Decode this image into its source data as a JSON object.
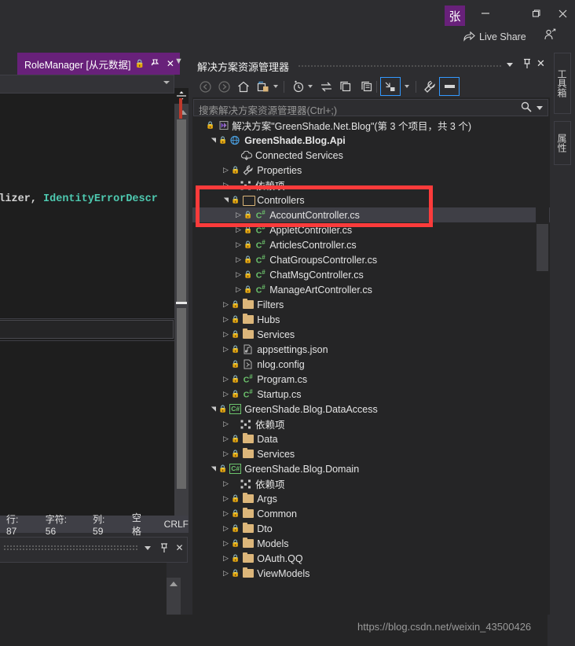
{
  "titlebar": {
    "avatar_initial": "张",
    "minimize_label": "minimize",
    "maximize_label": "maximize",
    "close_label": "close",
    "live_share_label": "Live Share",
    "accent_purple": "#68217a"
  },
  "editor": {
    "tab_label": "RoleManager [从元数据]",
    "tab_lock_icon": "lock-icon",
    "tab_pin_icon": "pin-icon",
    "tab_close_icon": "close-icon",
    "code_fragment_plain": "rmalizer, ",
    "code_fragment_type": "IdentityErrorDescr",
    "code_color_type": "#4ec9b0",
    "code_color_plain": "#d4d4d4"
  },
  "statusbar": {
    "line_label": "行: 87",
    "char_label": "字符: 56",
    "col_label": "列: 59",
    "whitespace_label": "空格",
    "eol_label": "CRLF"
  },
  "bottom_window": {
    "caret_icon": "chevron-down-icon",
    "pin_icon": "pin-icon",
    "close_icon": "close-icon"
  },
  "solution_explorer": {
    "title": "解决方案资源管理器",
    "caret_icon": "chevron-down-icon",
    "pin_icon": "pin-icon",
    "close_icon": "close-icon",
    "search_placeholder": "搜索解决方案资源管理器(Ctrl+;)",
    "search_icon": "magnifier-icon",
    "toolbar": [
      {
        "name": "back-button",
        "icon": "arrow-left-circle-icon",
        "enabled": false
      },
      {
        "name": "forward-button",
        "icon": "arrow-right-circle-icon",
        "enabled": false
      },
      {
        "name": "home-button",
        "icon": "home-icon",
        "enabled": true
      },
      {
        "name": "pending-changes-button",
        "icon": "pending-changes-icon",
        "enabled": true
      },
      {
        "name": "show-all-files-button",
        "icon": "clock-icon",
        "enabled": true
      },
      {
        "name": "sync-button",
        "icon": "sync-arrows-icon",
        "enabled": true
      },
      {
        "name": "collapse-all-button",
        "icon": "collapse-all-icon",
        "enabled": true
      },
      {
        "name": "properties-window-button",
        "icon": "copy-icon",
        "enabled": true
      },
      {
        "name": "preview-selected-items-button",
        "icon": "preview-arrow-icon",
        "enabled": true,
        "active": true
      },
      {
        "name": "properties-button",
        "icon": "wrench-icon",
        "enabled": true
      },
      {
        "name": "toggle-pane-button",
        "icon": "dash-icon",
        "enabled": true,
        "active": true
      }
    ],
    "highlight_color": "#fb3b3b",
    "tree": [
      {
        "indent": 0,
        "twisty": "",
        "icon": "solution-icon",
        "label": "解决方案\"GreenShade.Net.Blog\"(第 3 个项目，共 3 个)",
        "bold": false,
        "selected": false
      },
      {
        "indent": 1,
        "twisty": "▲",
        "icon": "web-project-icon",
        "label": "GreenShade.Blog.Api",
        "bold": true,
        "selected": false
      },
      {
        "indent": 2,
        "twisty": "",
        "icon": "connected-services-icon",
        "label": "Connected Services",
        "bold": false,
        "selected": false
      },
      {
        "indent": 2,
        "twisty": "▶",
        "icon": "wrench-icon",
        "label": "Properties",
        "bold": false,
        "selected": false
      },
      {
        "indent": 2,
        "twisty": "▶",
        "icon": "dependencies-icon",
        "label": "依赖项",
        "bold": false,
        "selected": false
      },
      {
        "indent": 2,
        "twisty": "▲",
        "icon": "folder-open-icon",
        "label": "Controllers",
        "bold": false,
        "selected": false
      },
      {
        "indent": 3,
        "twisty": "▶",
        "icon": "csharp-icon",
        "label": "AccountController.cs",
        "bold": false,
        "selected": true
      },
      {
        "indent": 3,
        "twisty": "▶",
        "icon": "csharp-icon",
        "label": "AppletController.cs",
        "bold": false,
        "selected": false
      },
      {
        "indent": 3,
        "twisty": "▶",
        "icon": "csharp-icon",
        "label": "ArticlesController.cs",
        "bold": false,
        "selected": false
      },
      {
        "indent": 3,
        "twisty": "▶",
        "icon": "csharp-icon",
        "label": "ChatGroupsController.cs",
        "bold": false,
        "selected": false
      },
      {
        "indent": 3,
        "twisty": "▶",
        "icon": "csharp-icon",
        "label": "ChatMsgController.cs",
        "bold": false,
        "selected": false
      },
      {
        "indent": 3,
        "twisty": "▶",
        "icon": "csharp-icon",
        "label": "ManageArtController.cs",
        "bold": false,
        "selected": false
      },
      {
        "indent": 2,
        "twisty": "▶",
        "icon": "folder-icon",
        "label": "Filters",
        "bold": false,
        "selected": false
      },
      {
        "indent": 2,
        "twisty": "▶",
        "icon": "folder-icon",
        "label": "Hubs",
        "bold": false,
        "selected": false
      },
      {
        "indent": 2,
        "twisty": "▶",
        "icon": "folder-icon",
        "label": "Services",
        "bold": false,
        "selected": false
      },
      {
        "indent": 2,
        "twisty": "▶",
        "icon": "json-icon",
        "label": "appsettings.json",
        "bold": false,
        "selected": false
      },
      {
        "indent": 2,
        "twisty": "",
        "icon": "config-icon",
        "label": "nlog.config",
        "bold": false,
        "selected": false
      },
      {
        "indent": 2,
        "twisty": "▶",
        "icon": "csharp-icon",
        "label": "Program.cs",
        "bold": false,
        "selected": false
      },
      {
        "indent": 2,
        "twisty": "▶",
        "icon": "csharp-icon",
        "label": "Startup.cs",
        "bold": false,
        "selected": false
      },
      {
        "indent": 1,
        "twisty": "▲",
        "icon": "csproj-icon",
        "label": "GreenShade.Blog.DataAccess",
        "bold": false,
        "selected": false
      },
      {
        "indent": 2,
        "twisty": "▶",
        "icon": "dependencies-icon",
        "label": "依赖项",
        "bold": false,
        "selected": false
      },
      {
        "indent": 2,
        "twisty": "▶",
        "icon": "folder-icon",
        "label": "Data",
        "bold": false,
        "selected": false
      },
      {
        "indent": 2,
        "twisty": "▶",
        "icon": "folder-icon",
        "label": "Services",
        "bold": false,
        "selected": false
      },
      {
        "indent": 1,
        "twisty": "▲",
        "icon": "csproj-icon",
        "label": "GreenShade.Blog.Domain",
        "bold": false,
        "selected": false
      },
      {
        "indent": 2,
        "twisty": "▶",
        "icon": "dependencies-icon",
        "label": "依赖项",
        "bold": false,
        "selected": false
      },
      {
        "indent": 2,
        "twisty": "▶",
        "icon": "folder-icon",
        "label": "Args",
        "bold": false,
        "selected": false
      },
      {
        "indent": 2,
        "twisty": "▶",
        "icon": "folder-icon",
        "label": "Common",
        "bold": false,
        "selected": false
      },
      {
        "indent": 2,
        "twisty": "▶",
        "icon": "folder-icon",
        "label": "Dto",
        "bold": false,
        "selected": false
      },
      {
        "indent": 2,
        "twisty": "▶",
        "icon": "folder-icon",
        "label": "Models",
        "bold": false,
        "selected": false
      },
      {
        "indent": 2,
        "twisty": "▶",
        "icon": "folder-icon",
        "label": "OAuth.QQ",
        "bold": false,
        "selected": false
      },
      {
        "indent": 2,
        "twisty": "▶",
        "icon": "folder-icon",
        "label": "ViewModels",
        "bold": false,
        "selected": false
      }
    ]
  },
  "right_tabs": [
    {
      "label": "工具箱"
    },
    {
      "label": "属性"
    }
  ],
  "watermark": "https://blog.csdn.net/weixin_43500426"
}
